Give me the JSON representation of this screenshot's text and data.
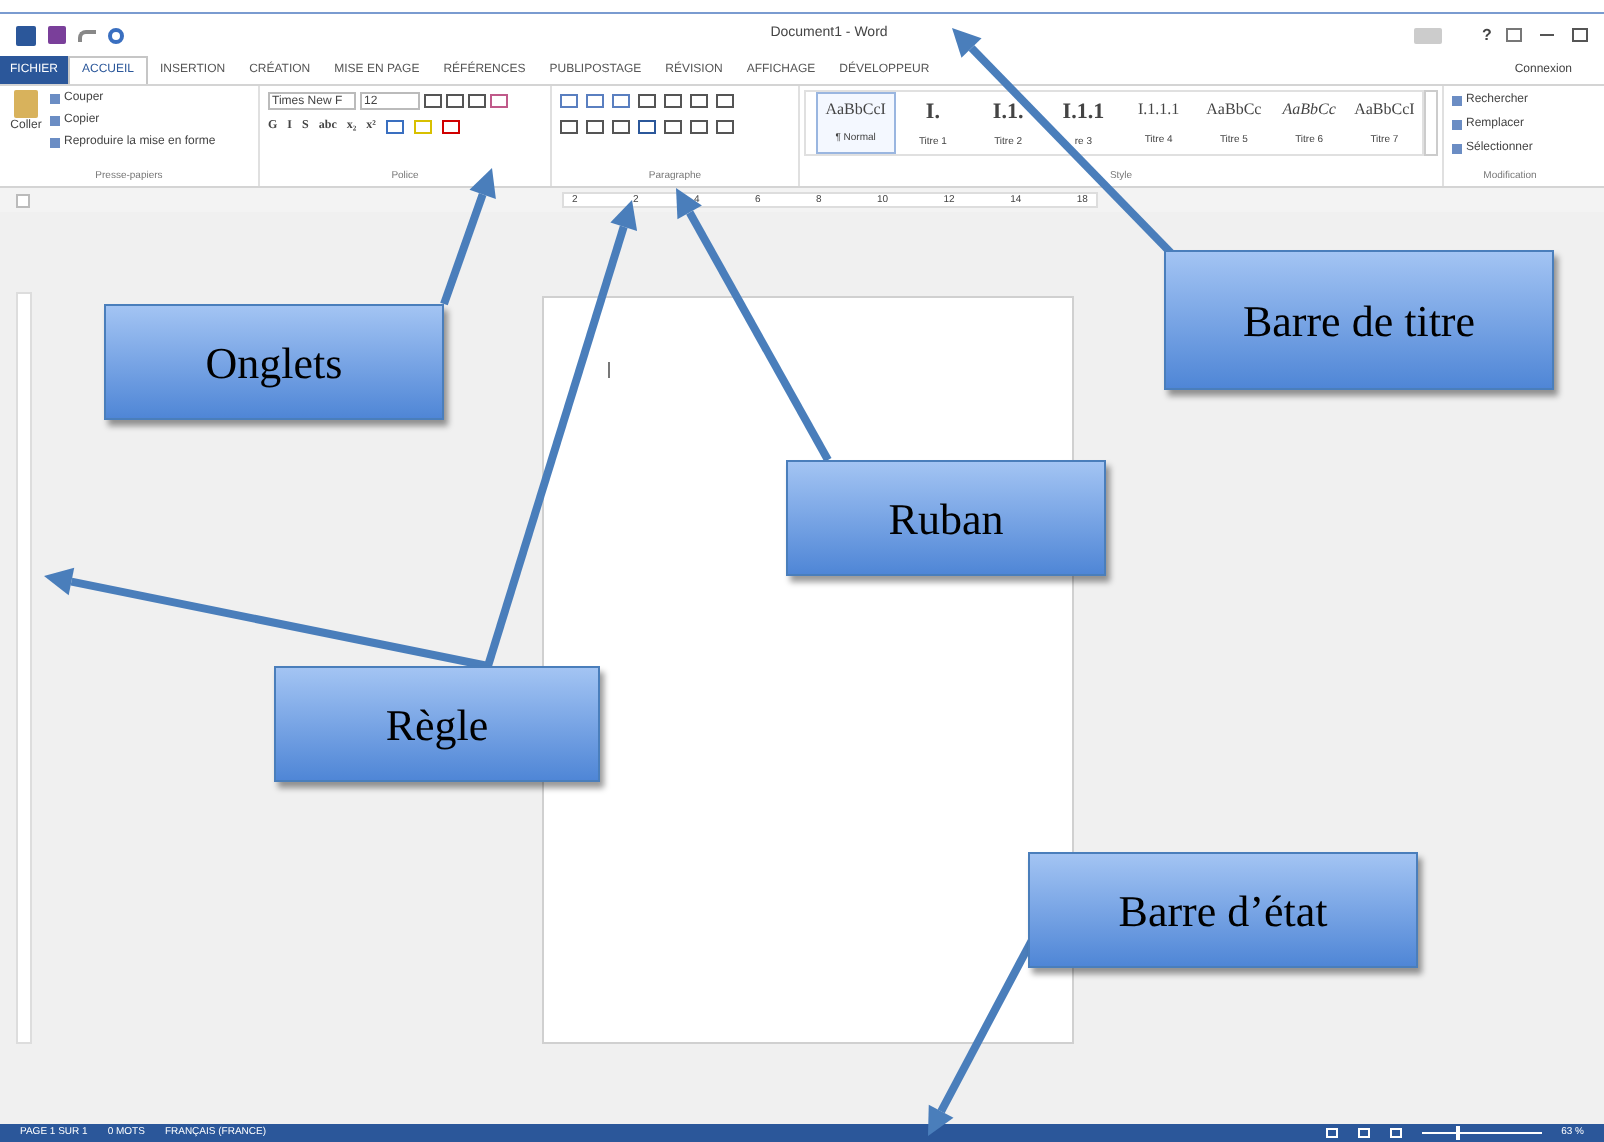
{
  "window": {
    "title": "Document1 - Word",
    "help": "?",
    "account": "Connexion"
  },
  "tabs": [
    {
      "label": "FICHIER",
      "kind": "file",
      "selected": false
    },
    {
      "label": "ACCUEIL",
      "kind": "tab",
      "selected": true
    },
    {
      "label": "INSERTION",
      "kind": "tab",
      "selected": false
    },
    {
      "label": "CRÉATION",
      "kind": "tab",
      "selected": false
    },
    {
      "label": "MISE EN PAGE",
      "kind": "tab",
      "selected": false
    },
    {
      "label": "RÉFÉRENCES",
      "kind": "tab",
      "selected": false
    },
    {
      "label": "PUBLIPOSTAGE",
      "kind": "tab",
      "selected": false
    },
    {
      "label": "RÉVISION",
      "kind": "tab",
      "selected": false
    },
    {
      "label": "AFFICHAGE",
      "kind": "tab",
      "selected": false
    },
    {
      "label": "DÉVELOPPEUR",
      "kind": "tab",
      "selected": false
    }
  ],
  "clipboard": {
    "paste": "Coller",
    "items": [
      "Couper",
      "Copier",
      "Reproduire la mise en forme"
    ],
    "label": "Presse-papiers"
  },
  "font": {
    "name": "Times New F",
    "size": "12",
    "format_buttons": [
      "G",
      "I",
      "S",
      "abc",
      "x₂",
      "x²"
    ],
    "label": "Police"
  },
  "paragraph": {
    "label": "Paragraphe"
  },
  "styles": {
    "label": "Style",
    "items": [
      {
        "sample": "AaBbCcI",
        "name": "¶ Normal",
        "kind": "plain",
        "selected": true
      },
      {
        "sample": "I.",
        "name": "Titre 1",
        "kind": "heading",
        "selected": false
      },
      {
        "sample": "I.1.",
        "name": "Titre 2",
        "kind": "heading",
        "selected": false
      },
      {
        "sample": "I.1.1",
        "name": "re 3",
        "kind": "heading",
        "selected": false
      },
      {
        "sample": "I.1.1.1",
        "name": "Titre 4",
        "kind": "plain",
        "selected": false
      },
      {
        "sample": "AaBbCc",
        "name": "Titre 5",
        "kind": "plain",
        "selected": false
      },
      {
        "sample": "AaBbCc",
        "name": "Titre 6",
        "kind": "italic",
        "selected": false
      },
      {
        "sample": "AaBbCcI",
        "name": "Titre 7",
        "kind": "plain",
        "selected": false
      }
    ]
  },
  "editing": {
    "label": "Modification",
    "items": [
      "Rechercher",
      "Remplacer",
      "Sélectionner"
    ]
  },
  "ruler": {
    "labels": [
      "2",
      "2",
      "4",
      "6",
      "8",
      "10",
      "12",
      "14",
      "18"
    ]
  },
  "status_bar": {
    "items": [
      "PAGE 1 SUR 1",
      "0 MOTS",
      "FRANÇAIS (FRANCE)"
    ],
    "zoom_slider": {
      "level": 0.3
    },
    "zoom": "63 %"
  },
  "callouts": [
    "Onglets",
    "Barre de titre",
    "Ruban",
    "Règle",
    "Barre d’état"
  ]
}
